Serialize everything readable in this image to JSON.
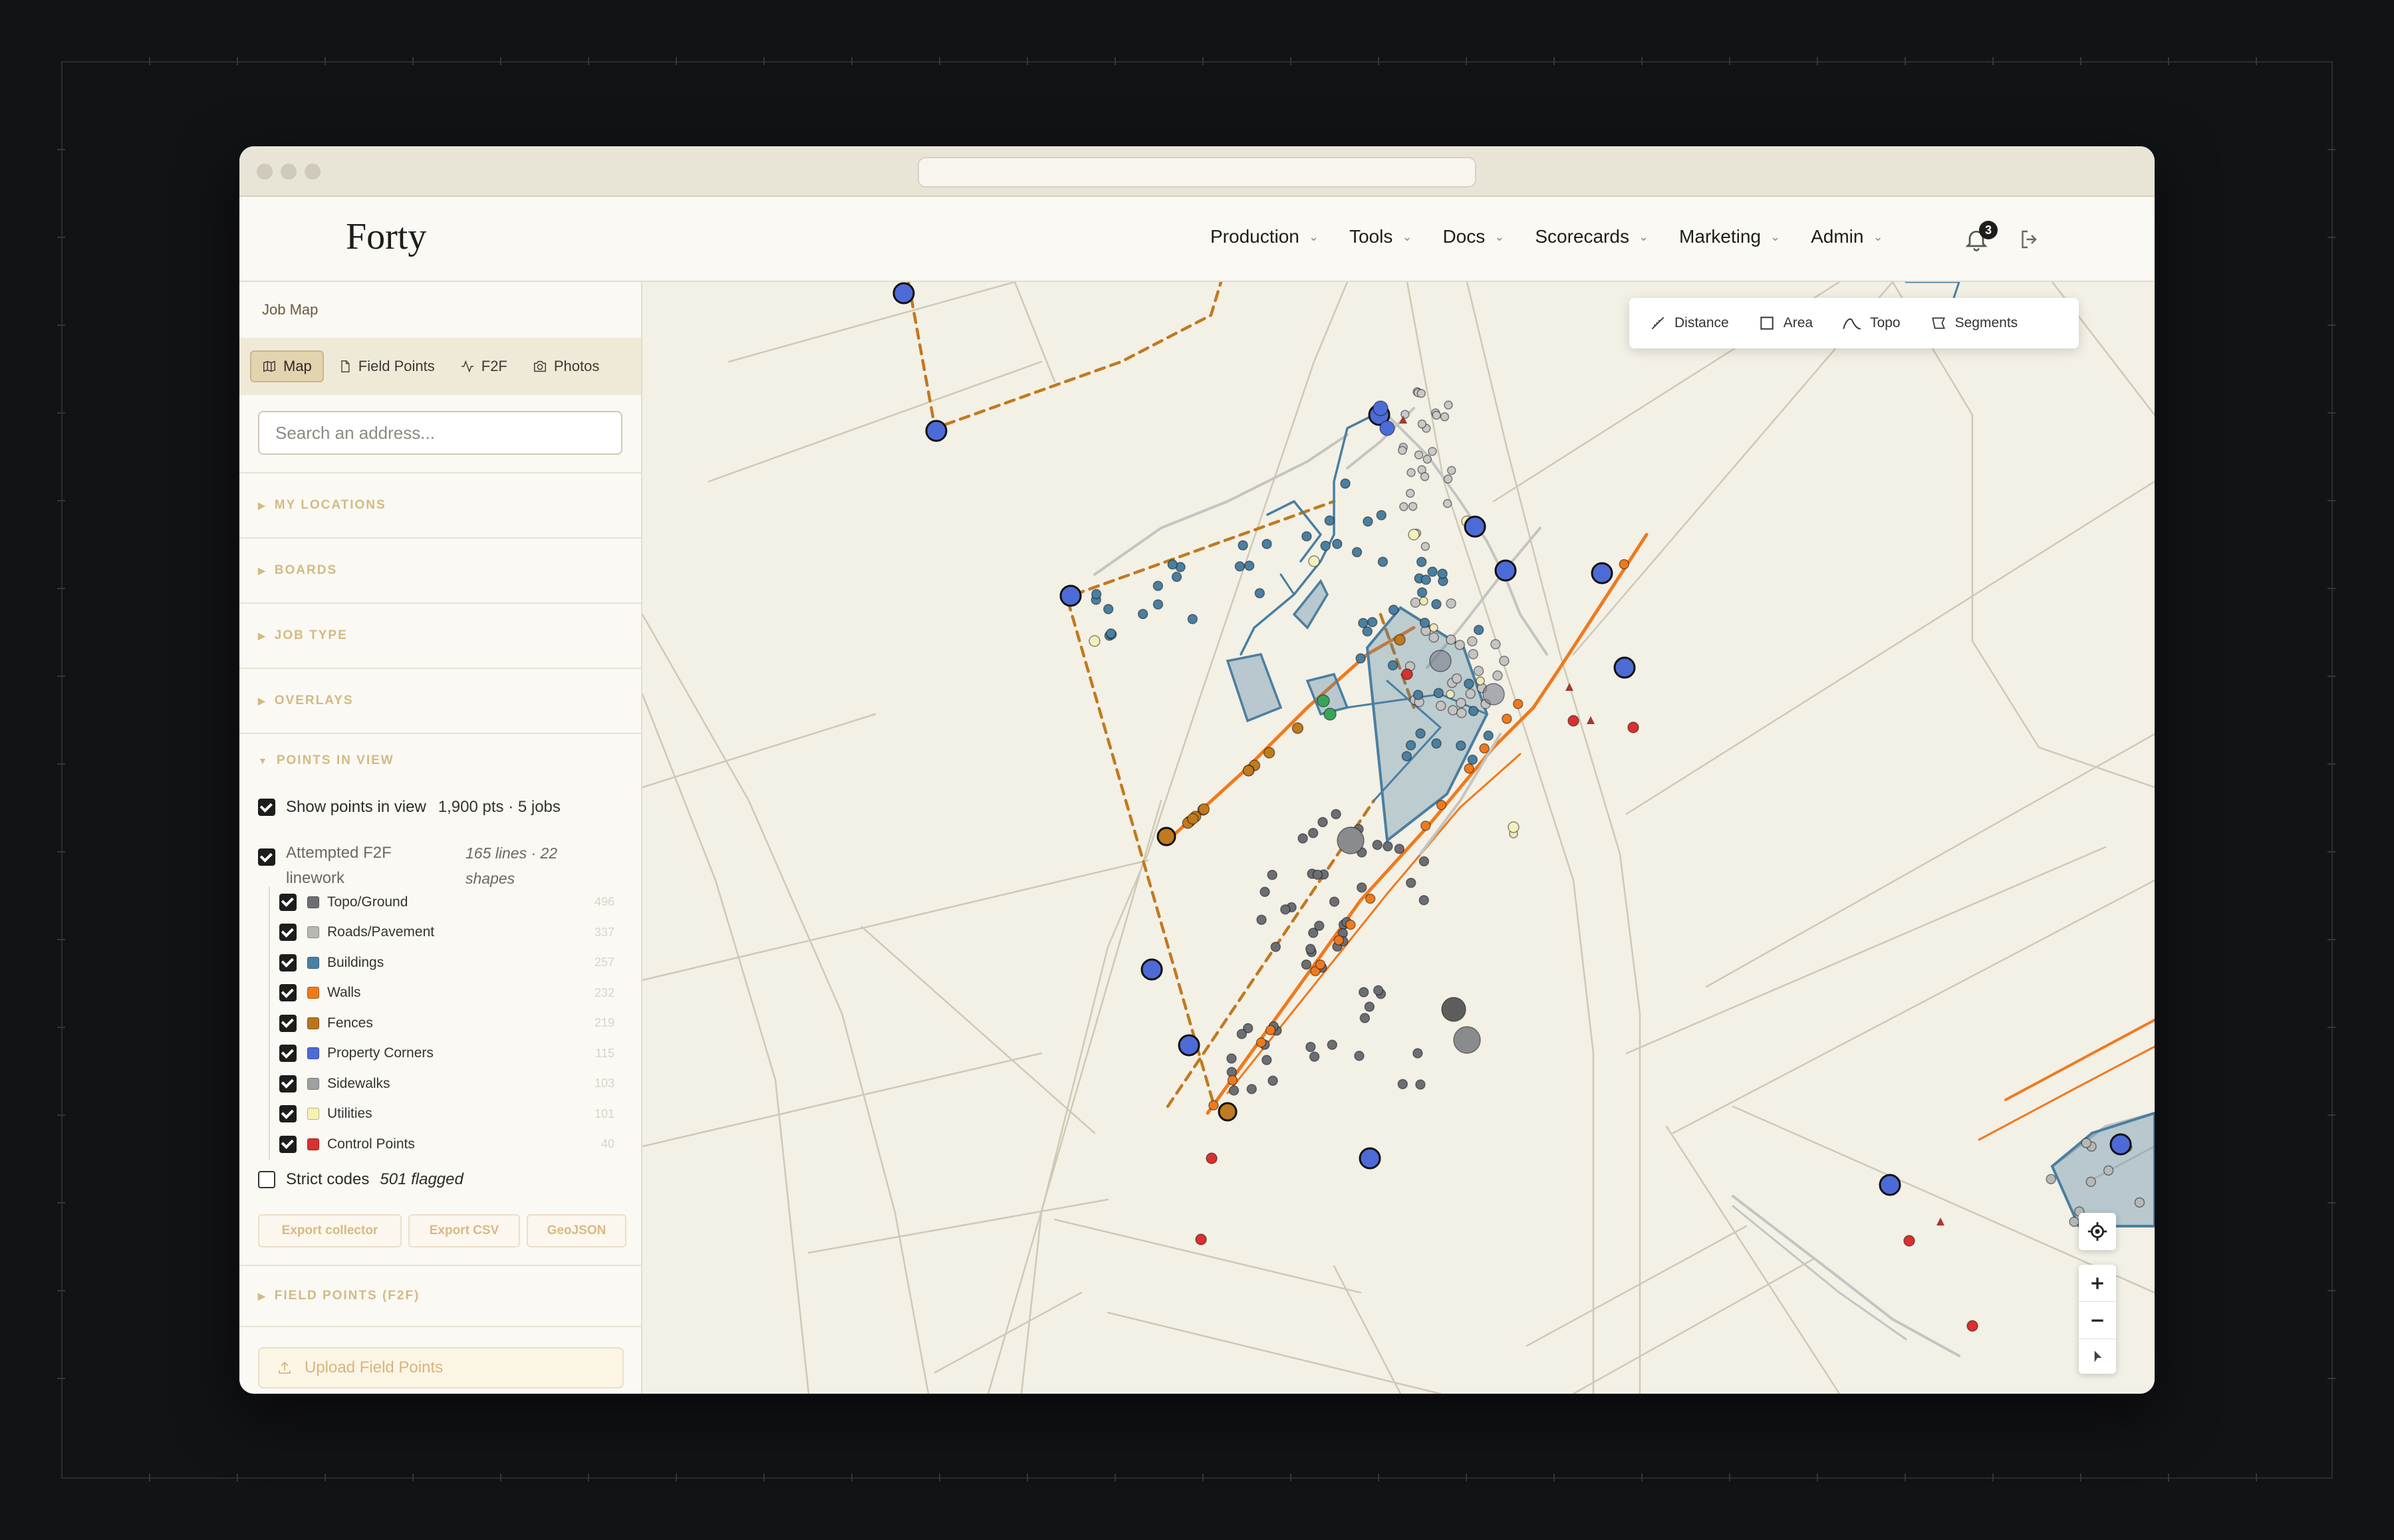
{
  "app": {
    "logo": "Forty"
  },
  "nav": {
    "items": [
      {
        "label": "Production"
      },
      {
        "label": "Tools"
      },
      {
        "label": "Docs"
      },
      {
        "label": "Scorecards"
      },
      {
        "label": "Marketing"
      },
      {
        "label": "Admin"
      }
    ],
    "notification_count": "3",
    "bell_icon": "bell-icon",
    "logout_icon": "logout-icon"
  },
  "sidebar": {
    "title": "Job Map",
    "tabs": [
      {
        "label": "Map",
        "icon": "map-icon",
        "active": true
      },
      {
        "label": "Field Points",
        "icon": "document-icon"
      },
      {
        "label": "F2F",
        "icon": "activity-icon"
      },
      {
        "label": "Photos",
        "icon": "camera-icon"
      }
    ],
    "search": {
      "placeholder": "Search an address..."
    },
    "sections": [
      "MY LOCATIONS",
      "BOARDS",
      "JOB TYPE",
      "OVERLAYS"
    ],
    "points_in_view": {
      "header": "POINTS IN VIEW",
      "show_points": {
        "label": "Show points in view",
        "meta": "1,900 pts · 5 jobs",
        "checked": true
      },
      "attempted": {
        "label": "Attempted F2F linework",
        "meta": "165 lines · 22 shapes",
        "checked": true
      },
      "layers": [
        {
          "label": "Topo/Ground",
          "count": "496",
          "color": "#6b6e73"
        },
        {
          "label": "Roads/Pavement",
          "count": "337",
          "color": "#b7b7b4"
        },
        {
          "label": "Buildings",
          "count": "257",
          "color": "#4a7fa0"
        },
        {
          "label": "Walls",
          "count": "232",
          "color": "#ef7a1e"
        },
        {
          "label": "Fences",
          "count": "219",
          "color": "#b87420"
        },
        {
          "label": "Property Corners",
          "count": "115",
          "color": "#4d6bd6"
        },
        {
          "label": "Sidewalks",
          "count": "103",
          "color": "#9ea0a3"
        },
        {
          "label": "Utilities",
          "count": "101",
          "color": "#f6f2b3"
        },
        {
          "label": "Control Points",
          "count": "40",
          "color": "#d93030"
        }
      ],
      "strict": {
        "label": "Strict codes",
        "meta": "501 flagged",
        "checked": false
      },
      "buttons": [
        "Export collector",
        "Export CSV",
        "GeoJSON"
      ]
    },
    "field_points_section": "FIELD POINTS (F2F)",
    "upload_label": "Upload Field Points"
  },
  "map_tools": [
    {
      "label": "Distance",
      "icon": "ruler-icon"
    },
    {
      "label": "Area",
      "icon": "square-icon"
    },
    {
      "label": "Topo",
      "icon": "topo-icon"
    },
    {
      "label": "Segments",
      "icon": "segments-icon"
    }
  ],
  "map_controls": [
    "locate-icon",
    "zoom-in-icon",
    "zoom-out-icon",
    "compass-icon"
  ],
  "colors": {
    "accent": "#d4b984",
    "map_bg": "#f3f0e6",
    "parcel_line": "#cfc9b5",
    "fence": "#c07a1f",
    "wall": "#ef7a1e",
    "building": "#4a7fa0",
    "road": "#c4c4c2",
    "topo": "#6b6e73",
    "corner": "#4d6bd6",
    "control": "#d93030"
  }
}
